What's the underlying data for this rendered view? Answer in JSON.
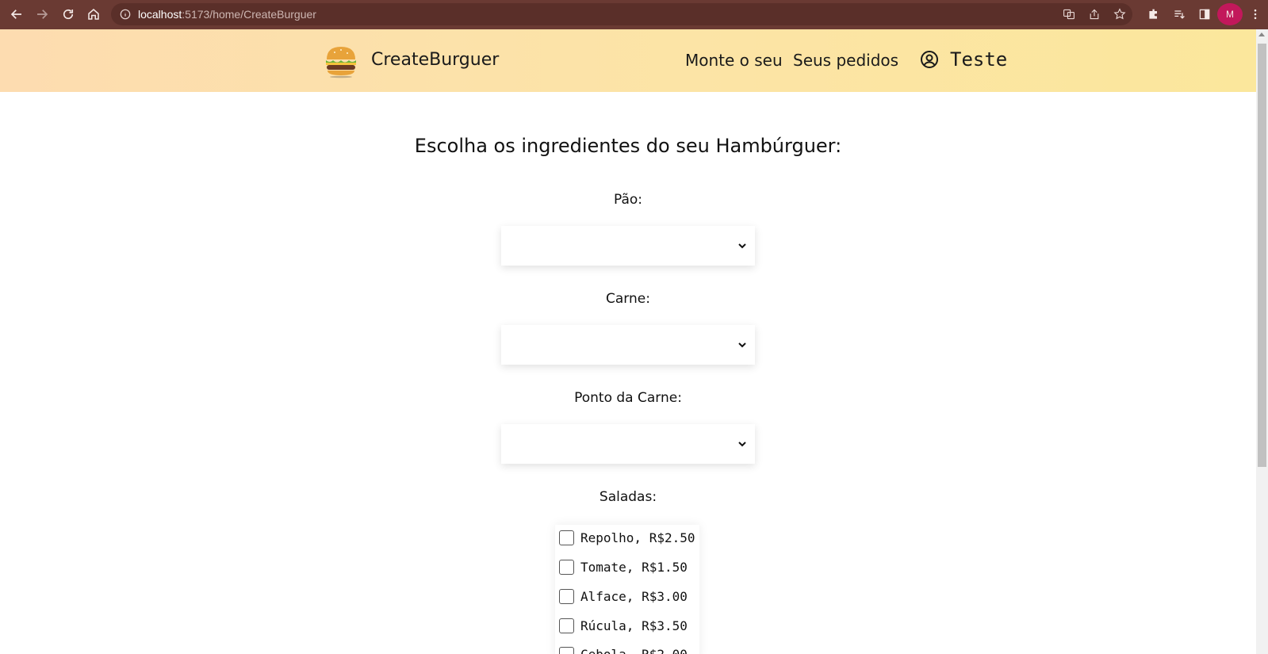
{
  "browser": {
    "url_host": "localhost",
    "url_path": ":5173/home/CreateBurguer",
    "avatar_letter": "M",
    "icons": [
      "back-icon",
      "forward-icon",
      "reload-icon",
      "home-icon",
      "info-icon",
      "translate-icon",
      "share-icon",
      "star-icon",
      "extensions-icon",
      "reading-list-icon",
      "side-panel-icon",
      "menu-icon"
    ]
  },
  "header": {
    "brand": "CreateBurguer",
    "nav": [
      "Monte o seu",
      "Seus pedidos"
    ],
    "user_name": "Teste"
  },
  "form": {
    "heading": "Escolha os ingredientes do seu Hambúrguer:",
    "bread_label": "Pão:",
    "meat_label": "Carne:",
    "doneness_label": "Ponto da Carne:",
    "salads_label": "Saladas:",
    "salads": [
      "Repolho, R$2.50",
      "Tomate, R$1.50",
      "Alface, R$3.00",
      "Rúcula, R$3.50",
      "Cebola, R$2.00"
    ]
  },
  "colors": {
    "chrome": "#6a3a33",
    "header_start": "#fddcb0",
    "header_end": "#fbe79c",
    "avatar": "#c2185b"
  }
}
